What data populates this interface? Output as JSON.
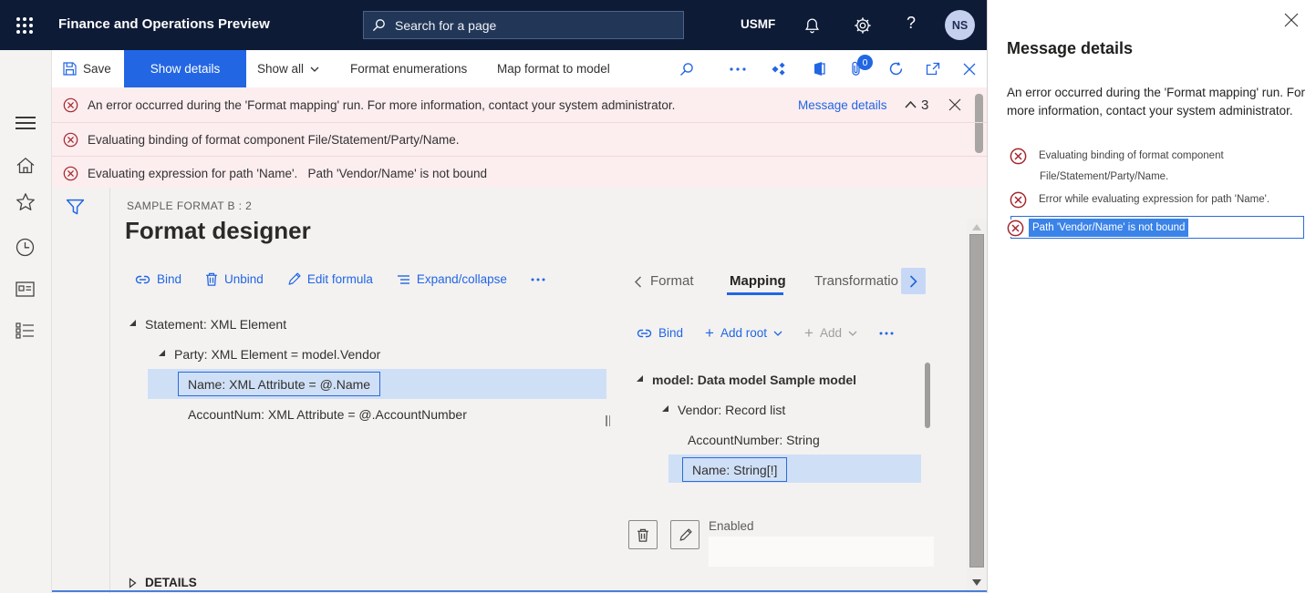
{
  "colors": {
    "primary": "#2266E3",
    "topbar_bg": "#0D1B36",
    "alert_bg": "#FCEDEF",
    "error_red": "#A4262C",
    "selection_bg": "#CFDFF6",
    "selection_border": "#2E6BD6",
    "content_bg": "#F3F2F1"
  },
  "icons": {
    "app-launcher-icon": "3x3 dot grid",
    "search-icon": "magnifier",
    "bell-icon": "bell",
    "gear-icon": "gear",
    "menu-icon": "hamburger lines",
    "home-icon": "house",
    "favorites-icon": "star",
    "recent-icon": "clock",
    "forms-icon": "window",
    "workspaces-icon": "list",
    "save-icon": "floppy disk",
    "chevron-down-icon": "∨",
    "more-icon": "⋯",
    "advisor-icon": "diamonds",
    "office-icon": "book",
    "attach-icon": "paperclip",
    "refresh-icon": "circular arrow",
    "popout-icon": "open in new window",
    "close-icon": "✕",
    "error-icon": "circled ✕",
    "filter-icon": "funnel",
    "bind-icon": "chain link",
    "unbind-icon": "trash can",
    "edit-icon": "pencil",
    "expand-collapse-icon": "list lines",
    "tree-expanded-icon": "◢",
    "details-collapsed-icon": "▷",
    "chevron-left-icon": "‹",
    "chevron-right-icon": "›",
    "caret-up-icon": "︿"
  },
  "topbar": {
    "app_title": "Finance and Operations Preview",
    "search_placeholder": "Search for a page",
    "company": "USMF",
    "help_label": "?",
    "avatar_initials": "NS"
  },
  "action_bar": {
    "save": "Save",
    "show_details": "Show details",
    "show_all": "Show all",
    "format_enumerations": "Format enumerations",
    "map_format_to_model": "Map format to model",
    "attachment_count": "0"
  },
  "alerts": {
    "count": "3",
    "message_details_link": "Message details",
    "items": [
      {
        "text": "An error occurred during the 'Format mapping' run. For more information, contact your system administrator."
      },
      {
        "text": "Evaluating binding of format component File/Statement/Party/Name."
      },
      {
        "text": "Evaluating expression for path 'Name'.   Path 'Vendor/Name' is not bound"
      }
    ]
  },
  "page": {
    "caption": "SAMPLE FORMAT B : 2",
    "title": "Format designer",
    "details_label": "DETAILS"
  },
  "format_tree": {
    "toolbar": {
      "bind": "Bind",
      "unbind": "Unbind",
      "edit_formula": "Edit formula",
      "expand_collapse": "Expand/collapse"
    },
    "nodes": [
      {
        "label": "Statement: XML Element",
        "level": 0,
        "expanded": true
      },
      {
        "label": "Party: XML Element = model.Vendor",
        "level": 1,
        "expanded": true
      },
      {
        "label": "Name: XML Attribute = @.Name",
        "level": 2,
        "selected": true
      },
      {
        "label": "AccountNum: XML Attribute = @.AccountNumber",
        "level": 2
      }
    ]
  },
  "mapping_panel": {
    "tabs": [
      {
        "label": "Format"
      },
      {
        "label": "Mapping",
        "active": true
      },
      {
        "label": "Transformatio"
      }
    ],
    "toolbar": {
      "bind": "Bind",
      "add_root": "Add root",
      "add": "Add"
    },
    "nodes": [
      {
        "label": "model: Data model Sample model",
        "level": 0,
        "expanded": true,
        "bold": true
      },
      {
        "label": "Vendor: Record list",
        "level": 1,
        "expanded": true
      },
      {
        "label": "AccountNumber: String",
        "level": 2
      },
      {
        "label": "Name: String[!]",
        "level": 2,
        "selected": true
      }
    ],
    "enabled_label": "Enabled",
    "enabled_value": ""
  },
  "message_details": {
    "title": "Message details",
    "summary": "An error occurred during the 'Format mapping' run. For more information, contact your system administrator.",
    "errors": [
      {
        "line1": "Evaluating binding of format component",
        "line2": "File/Statement/Party/Name."
      },
      {
        "line1": "Error while evaluating expression for path 'Name'."
      },
      {
        "line1": "Path 'Vendor/Name' is not bound",
        "selected": true
      }
    ]
  }
}
